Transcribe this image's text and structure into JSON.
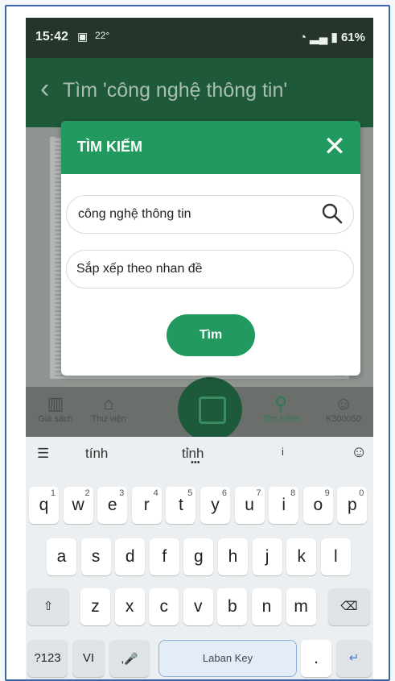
{
  "status": {
    "time": "15:42",
    "temp": "22°",
    "battery": "61%"
  },
  "appbar": {
    "title": "Tìm 'công nghệ thông tin'"
  },
  "dialog": {
    "title": "TÌM KIẾM",
    "search_value": "công nghệ thông tin",
    "sort_label": "Sắp xếp theo nhan đề",
    "submit_label": "Tìm"
  },
  "bottom_nav": {
    "items": [
      {
        "label": "Giá sách",
        "icon": "bookshelf-icon"
      },
      {
        "label": "Thư viện",
        "icon": "library-icon"
      },
      {
        "label": "Tìm kiếm",
        "icon": "search-icon"
      },
      {
        "label": "K300050",
        "icon": "user-icon"
      }
    ]
  },
  "keyboard": {
    "suggestions": [
      "tính",
      "tỉnh",
      "i"
    ],
    "row1": [
      {
        "k": "q",
        "n": "1"
      },
      {
        "k": "w",
        "n": "2"
      },
      {
        "k": "e",
        "n": "3"
      },
      {
        "k": "r",
        "n": "4"
      },
      {
        "k": "t",
        "n": "5"
      },
      {
        "k": "y",
        "n": "6"
      },
      {
        "k": "u",
        "n": "7"
      },
      {
        "k": "i",
        "n": "8"
      },
      {
        "k": "o",
        "n": "9"
      },
      {
        "k": "p",
        "n": "0"
      }
    ],
    "row2": [
      "a",
      "s",
      "d",
      "f",
      "g",
      "h",
      "j",
      "k",
      "l"
    ],
    "row3": [
      "z",
      "x",
      "c",
      "v",
      "b",
      "n",
      "m"
    ],
    "symbols_label": "?123",
    "lang_label": "VI",
    "space_label": "Laban Key",
    "period_label": "."
  },
  "colors": {
    "accent": "#229a5f",
    "frame": "#3a66a8"
  }
}
